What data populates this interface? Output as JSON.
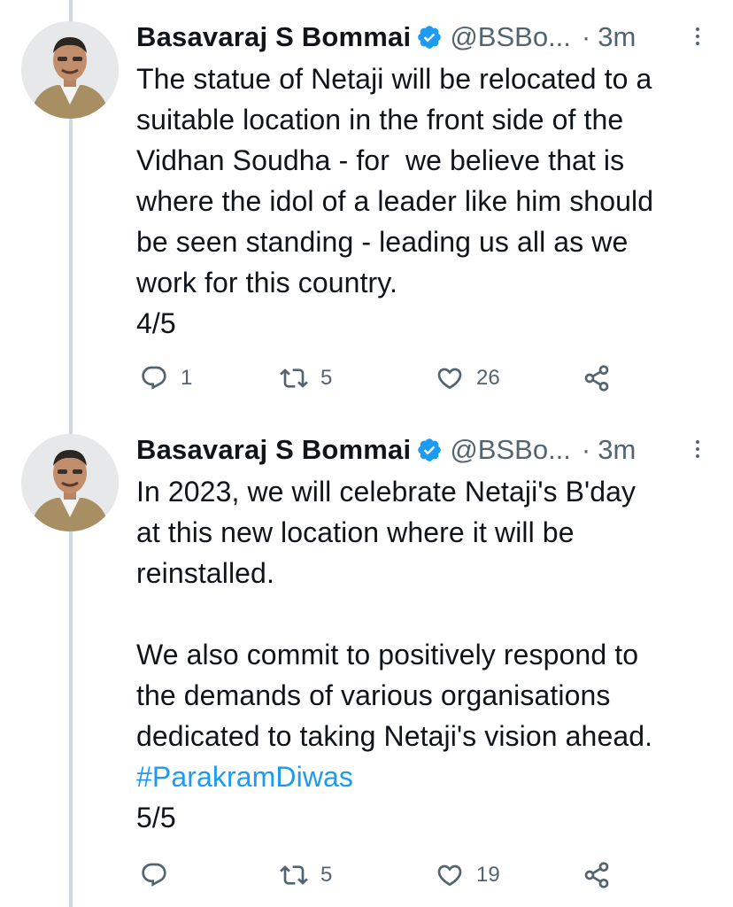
{
  "tweets": [
    {
      "author": {
        "name": "Basavaraj S Bommai",
        "handle": "@BSBo...",
        "separator": "·",
        "time": "3m",
        "verified": true
      },
      "text": "The statue of Netaji will be relocated to a\nsuitable location in the front side of the\nVidhan Soudha - for  we believe that is\nwhere the idol of a leader like him should\nbe seen standing - leading us all as we\nwork for this country.\n4/5",
      "actions": {
        "reply_count": "1",
        "retweet_count": "5",
        "like_count": "26"
      }
    },
    {
      "author": {
        "name": "Basavaraj S Bommai",
        "handle": "@BSBo...",
        "separator": "·",
        "time": "3m",
        "verified": true
      },
      "text_before_hashtag": "In 2023, we will celebrate Netaji's B'day\nat this new location where it will be\nreinstalled.\n\nWe also commit to positively respond to\nthe demands of various organisations\ndedicated to taking Netaji's vision ahead.\n",
      "hashtag": "#ParakramDiwas",
      "text_after_hashtag": "\n5/5",
      "actions": {
        "reply_count": "",
        "retweet_count": "5",
        "like_count": "19"
      }
    }
  ],
  "colors": {
    "text": "#0f1419",
    "secondary": "#536471",
    "link": "#1d9bf0",
    "verified_badge": "#1d9bf0",
    "thread_line": "#cfd9de"
  },
  "icons": [
    "verified-badge-icon",
    "more-options-icon",
    "reply-icon",
    "retweet-icon",
    "like-icon",
    "share-icon"
  ]
}
